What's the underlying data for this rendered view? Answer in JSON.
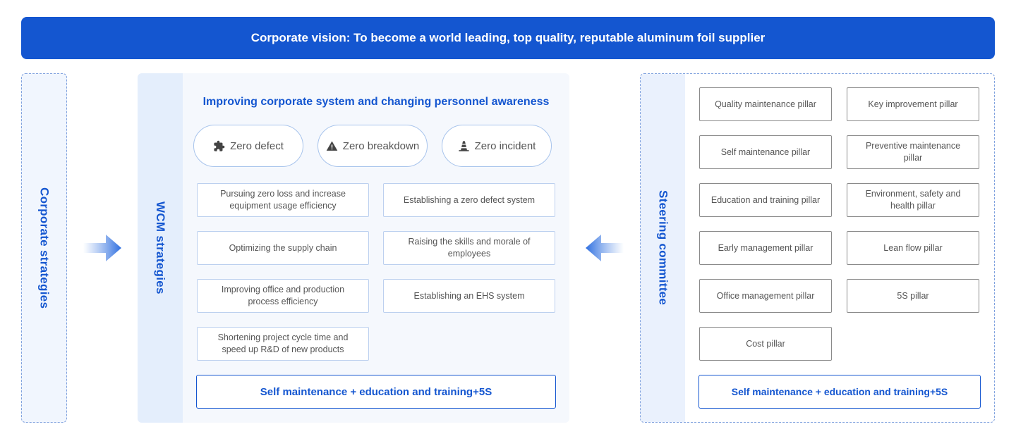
{
  "vision": "Corporate vision: To become a world leading, top quality, reputable aluminum foil supplier",
  "corporate": {
    "label": "Corporate strategies"
  },
  "wcm": {
    "label": "WCM strategies",
    "title": "Improving corporate system and changing personnel awareness",
    "zeros": [
      {
        "label": "Zero defect",
        "icon": "puzzle-icon"
      },
      {
        "label": "Zero breakdown",
        "icon": "warning-icon"
      },
      {
        "label": "Zero incident",
        "icon": "traffic-cone-icon"
      }
    ],
    "objectives": [
      "Pursuing zero loss and increase equipment usage efficiency",
      "Establishing a zero defect system",
      "Optimizing the supply chain",
      "Raising the skills and morale of employees",
      "Improving office and production process efficiency",
      "Establishing an EHS system",
      "Shortening project cycle time and speed up R&D of new products"
    ],
    "bottom": "Self maintenance + education and training+5S"
  },
  "steering": {
    "label": "Steering committee",
    "pillars": [
      "Quality maintenance pillar",
      "Key improvement pillar",
      "Self maintenance pillar",
      "Preventive maintenance pillar",
      "Education and training pillar",
      "Environment, safety and health pillar",
      "Early management pillar",
      "Lean flow pillar",
      "Office management pillar",
      "5S pillar",
      "Cost pillar"
    ],
    "bottom": "Self maintenance + education and training+5S"
  },
  "colors": {
    "primary": "#1456d0",
    "panel": "#f5f8fd",
    "side": "#e4eefc"
  }
}
